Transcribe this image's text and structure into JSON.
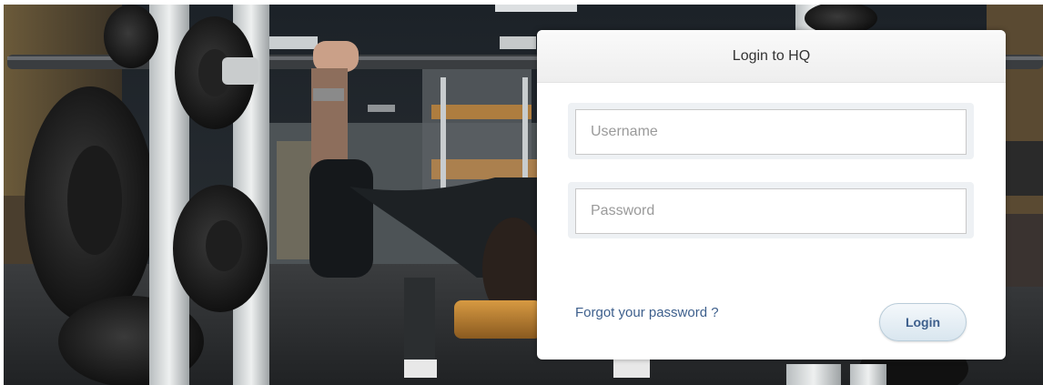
{
  "login": {
    "title": "Login to HQ",
    "username_placeholder": "Username",
    "password_placeholder": "Password",
    "forgot_link": "Forgot your password ?",
    "login_button": "Login"
  },
  "colors": {
    "link": "#3d5f8c",
    "header_bg": "#f2f2f2",
    "card_bg": "#ffffff"
  }
}
